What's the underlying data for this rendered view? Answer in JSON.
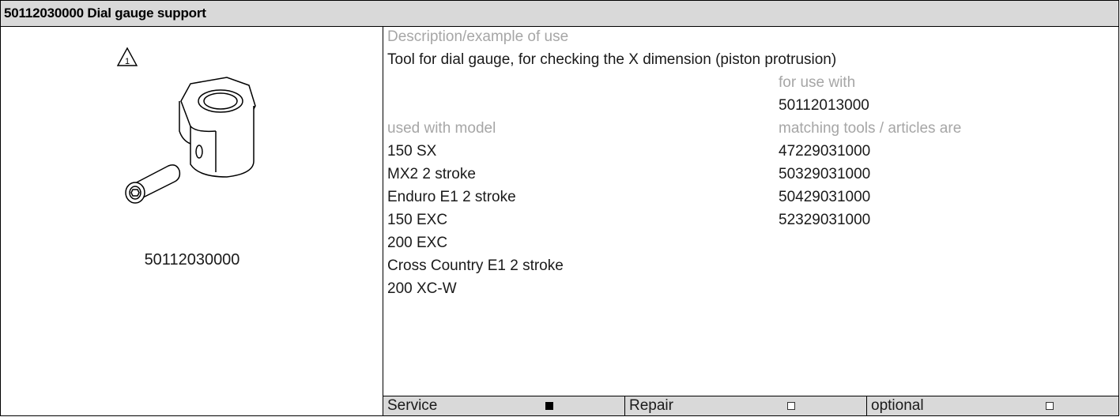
{
  "header": {
    "title": "50112030000 Dial gauge support"
  },
  "figure": {
    "part_number": "50112030000",
    "callout_number": "1",
    "icon": "warning-triangle-icon"
  },
  "description": {
    "label": "Description/example of use",
    "text": "Tool for dial gauge, for checking the X dimension (piston protrusion)"
  },
  "for_use_with": {
    "label": "for use with",
    "value": "50112013000"
  },
  "models": {
    "label": "used with model",
    "items": [
      "150 SX",
      "MX2 2 stroke",
      "Enduro E1 2 stroke",
      "150 EXC",
      "200 EXC",
      "Cross Country E1 2 stroke",
      "200 XC-W"
    ]
  },
  "matching": {
    "label": "matching tools / articles are",
    "items": [
      "47229031000",
      "50329031000",
      "50429031000",
      "52329031000"
    ]
  },
  "footer": {
    "items": [
      {
        "label": "Service",
        "checked": true
      },
      {
        "label": "Repair",
        "checked": false
      },
      {
        "label": "optional",
        "checked": false
      }
    ]
  }
}
